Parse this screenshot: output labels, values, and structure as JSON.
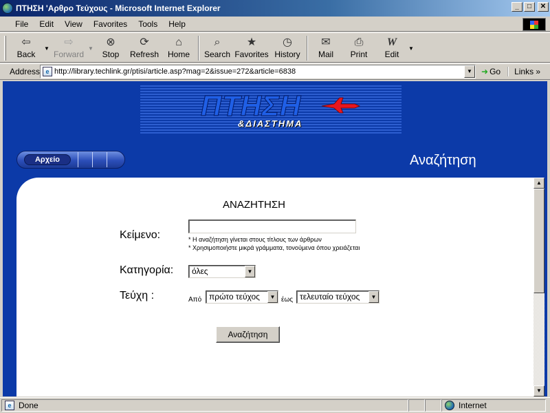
{
  "window": {
    "title": "ΠΤΗΣΗ 'Αρθρο Τεύχους - Microsoft Internet Explorer",
    "minimize_glyph": "_",
    "maximize_glyph": "□",
    "close_glyph": "✕"
  },
  "menu": {
    "items": [
      "File",
      "Edit",
      "View",
      "Favorites",
      "Tools",
      "Help"
    ]
  },
  "toolbar": {
    "back": "Back",
    "forward": "Forward",
    "stop": "Stop",
    "refresh": "Refresh",
    "home": "Home",
    "search": "Search",
    "favorites": "Favorites",
    "history": "History",
    "mail": "Mail",
    "print": "Print",
    "edit": "Edit"
  },
  "address": {
    "label": "Address",
    "url": "http://library.techlink.gr/ptisi/article.asp?mag=2&issue=272&article=6838",
    "go": "Go",
    "links": "Links"
  },
  "site": {
    "logo_main": "ΠΤΗΣΗ",
    "logo_sub": "&ΔΙΑΣΤΗΜΑ",
    "nav_archive": "Αρχείο",
    "section_title": "Αναζήτηση"
  },
  "form": {
    "heading": "ΑΝΑΖΗΤΗΣΗ",
    "text_label": "Κείμενο:",
    "text_value": "",
    "hint_1": "* Η αναζήτηση γίνεται στους τίτλους των άρθρων",
    "hint_2": "* Χρησιμοποιήστε μικρά γράμματα, τονούμενα όπου χρειάζεται",
    "category_label": "Κατηγορία:",
    "category_value": "όλες",
    "issues_label": "Τεύχη :",
    "from_label": "Από",
    "from_value": "πρώτο τεύχος",
    "to_label": "έως",
    "to_value": "τελευταίο τεύχος",
    "submit": "Αναζήτηση"
  },
  "status": {
    "text": "Done",
    "zone": "Internet"
  },
  "colors": {
    "site_blue": "#0c3aa8",
    "title_bar": "#0a246a"
  }
}
